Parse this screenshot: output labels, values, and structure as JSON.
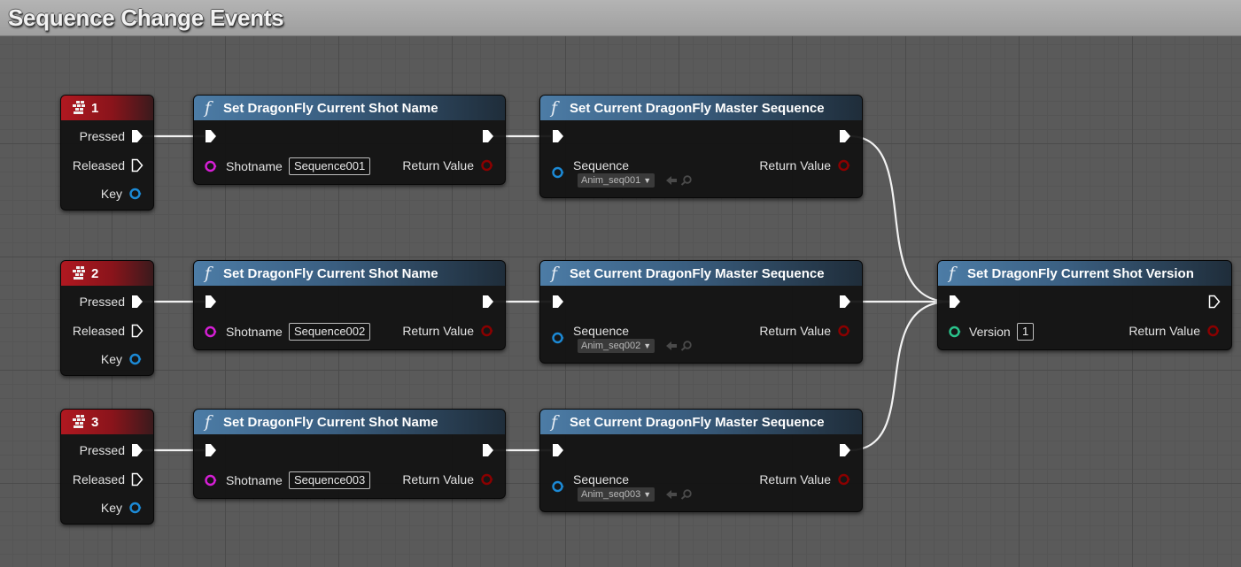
{
  "comment": {
    "title": "Sequence Change Events"
  },
  "colors": {
    "exec": "#ffffff",
    "string_pin": "#d61fd6",
    "object_pin": "#1c8ad6",
    "bool_pin": "#8b0000",
    "int_pin": "#2ac48c",
    "key_header": "#b01820",
    "function_header": "#4c7ca6"
  },
  "labels": {
    "pressed": "Pressed",
    "released": "Released",
    "key": "Key",
    "shotname": "Shotname",
    "return_value": "Return Value",
    "sequence": "Sequence",
    "version": "Version"
  },
  "rows": [
    {
      "key_event": {
        "icon": "keyboard-icon",
        "title": "1"
      },
      "shot_name_node": {
        "title": "Set DragonFly Current Shot Name",
        "shotname": "Sequence001"
      },
      "master_seq_node": {
        "title": "Set Current DragonFly Master Sequence",
        "sequence": "Anim_seq001"
      }
    },
    {
      "key_event": {
        "icon": "keyboard-icon",
        "title": "2"
      },
      "shot_name_node": {
        "title": "Set DragonFly Current Shot Name",
        "shotname": "Sequence002"
      },
      "master_seq_node": {
        "title": "Set Current DragonFly Master Sequence",
        "sequence": "Anim_seq002"
      }
    },
    {
      "key_event": {
        "icon": "keyboard-icon",
        "title": "3"
      },
      "shot_name_node": {
        "title": "Set DragonFly Current Shot Name",
        "shotname": "Sequence003"
      },
      "master_seq_node": {
        "title": "Set Current DragonFly Master Sequence",
        "sequence": "Anim_seq003"
      }
    }
  ],
  "version_node": {
    "title": "Set DragonFly Current Shot Version",
    "version": "1"
  }
}
